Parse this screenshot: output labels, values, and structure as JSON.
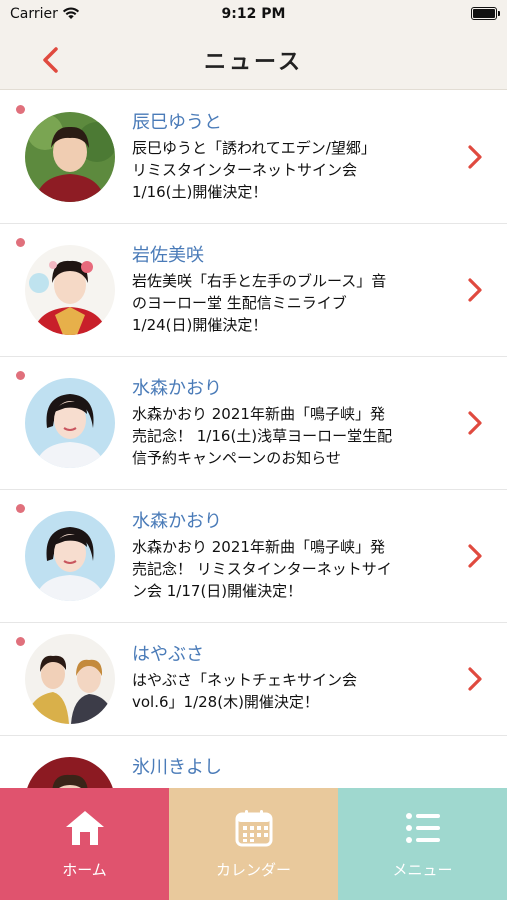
{
  "status": {
    "carrier": "Carrier",
    "time": "9:12 PM"
  },
  "nav": {
    "title": "ニュース"
  },
  "news": [
    {
      "artist": "辰巳ゆうと",
      "lines": [
        "辰巳ゆうと「誘われてエデン/望郷」",
        "リミスタインターネットサイン会",
        "1/16(土)開催決定！"
      ]
    },
    {
      "artist": "岩佐美咲",
      "lines": [
        "岩佐美咲「右手と左手のブルース」音",
        "のヨーロー堂 生配信ミニライブ",
        "1/24(日)開催決定！"
      ]
    },
    {
      "artist": "水森かおり",
      "lines": [
        "水森かおり 2021年新曲「鳴子峡」発",
        "売記念！ 1/16(土)浅草ヨーロー堂生配",
        "信予約キャンペーンのお知らせ"
      ]
    },
    {
      "artist": "水森かおり",
      "lines": [
        "水森かおり 2021年新曲「鳴子峡」発",
        "売記念！ リミスタインターネットサイ",
        "ン会 1/17(日)開催決定！"
      ]
    },
    {
      "artist": "はやぶさ",
      "lines": [
        "はやぶさ「ネットチェキサイン会",
        "vol.6」1/28(木)開催決定！"
      ]
    },
    {
      "artist": "氷川きよし",
      "lines": [
        ""
      ]
    }
  ],
  "tabs": [
    {
      "label": "ホーム",
      "icon": "home-icon"
    },
    {
      "label": "カレンダー",
      "icon": "calendar-icon"
    },
    {
      "label": "メニュー",
      "icon": "menu-icon"
    }
  ],
  "colors": {
    "accent": "#e04a3f",
    "artist_name": "#4a7bb8",
    "tab_home": "#e0536e",
    "tab_calendar": "#e9c99c",
    "tab_menu": "#9fd8cf",
    "unread_dot": "#e0707c"
  }
}
